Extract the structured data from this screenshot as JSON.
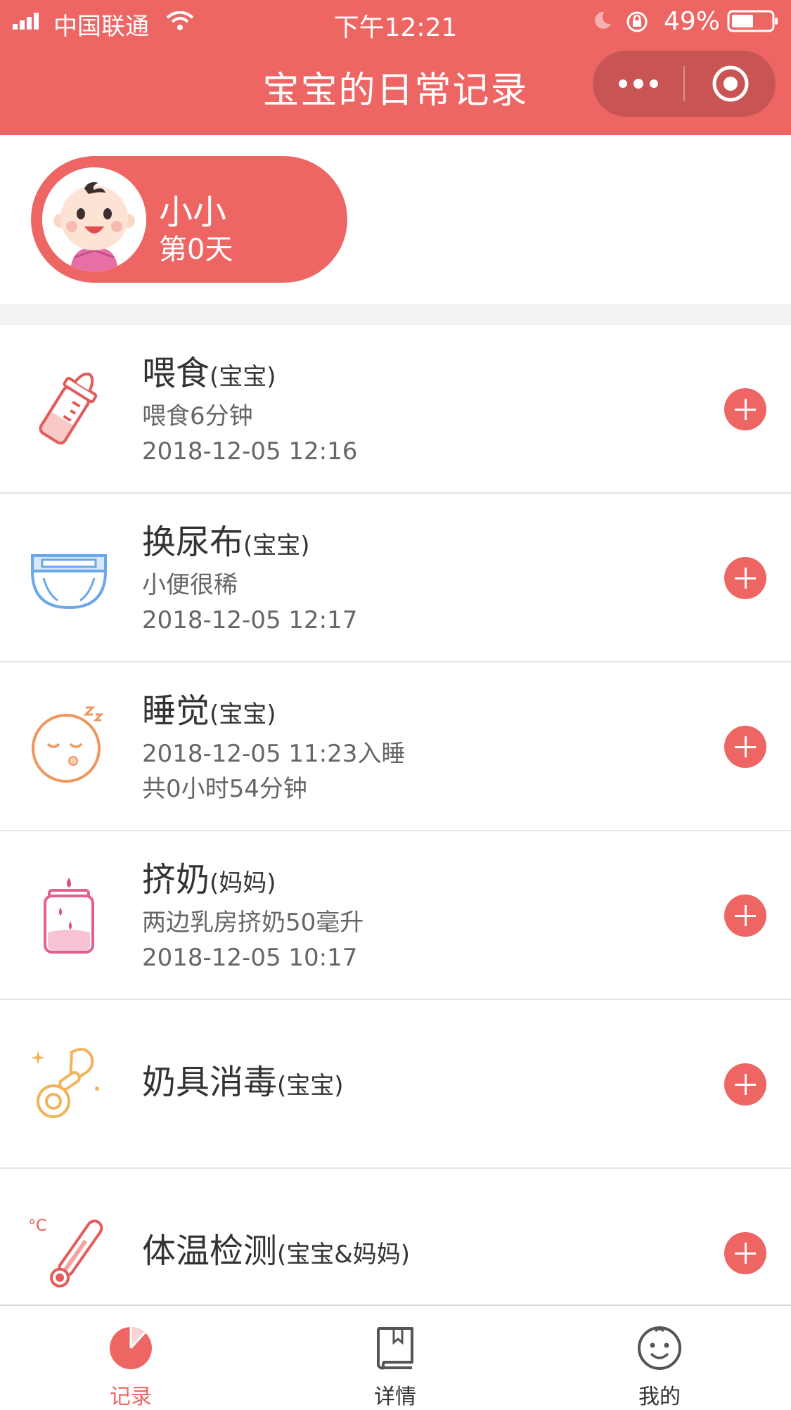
{
  "status_bar": {
    "carrier": "中国联通",
    "time": "下午12:21",
    "battery": "49%",
    "icons": [
      "signal-icon",
      "wifi-icon",
      "moon-icon",
      "orientation-lock-icon",
      "battery-icon"
    ]
  },
  "nav": {
    "title": "宝宝的日常记录",
    "icons": [
      "more-icon",
      "close-mini-program-icon"
    ]
  },
  "profile": {
    "name": "小小",
    "days": "第0天",
    "avatar_icon": "baby-avatar-icon"
  },
  "records": [
    {
      "title": "喂食",
      "tag": "(宝宝)",
      "line1": "喂食6分钟",
      "line2": "2018-12-05 12:16",
      "icon": "baby-bottle-icon"
    },
    {
      "title": "换尿布",
      "tag": "(宝宝)",
      "line1": "小便很稀",
      "line2": "2018-12-05 12:17",
      "icon": "diaper-icon"
    },
    {
      "title": "睡觉",
      "tag": "(宝宝)",
      "line1": "2018-12-05 11:23入睡",
      "line2": "共0小时54分钟",
      "icon": "sleeping-face-icon"
    },
    {
      "title": "挤奶",
      "tag": "(妈妈)",
      "line1": "两边乳房挤奶50毫升",
      "line2": "2018-12-05 10:17",
      "icon": "breast-pump-icon"
    },
    {
      "title": "奶具消毒",
      "tag": "(宝宝)",
      "icon": "pacifier-icon"
    },
    {
      "title": "体温检测",
      "tag": "(宝宝&妈妈)",
      "icon": "thermometer-icon"
    }
  ],
  "tabs": [
    {
      "label": "记录",
      "icon": "record-pie-icon",
      "active": true
    },
    {
      "label": "详情",
      "icon": "book-icon",
      "active": false
    },
    {
      "label": "我的",
      "icon": "smiley-face-icon",
      "active": false
    }
  ],
  "colors": {
    "accent": "#ee6663",
    "accent_dark": "#c85553",
    "text": "#333333",
    "subtext": "#666666"
  }
}
